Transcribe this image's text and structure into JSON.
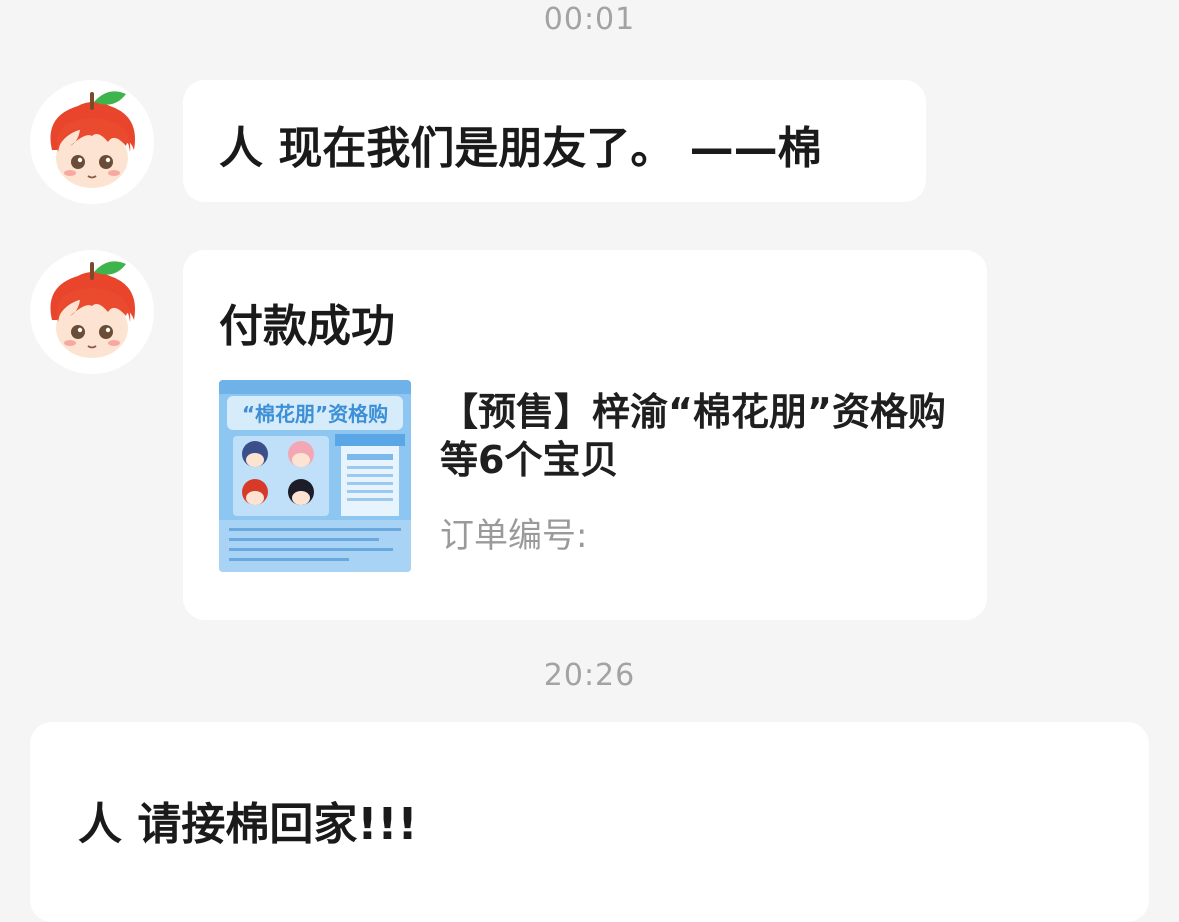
{
  "timestamps": [
    "00:01",
    "20:26"
  ],
  "messages": {
    "m1": {
      "text": "人 现在我们是朋友了。  ——棉"
    },
    "m2": {
      "title": "付款成功",
      "thumb_title": "“棉花朋”资格购",
      "product_title": "【预售】梓渝“棉花朋”资格购等6个宝贝",
      "order_label": "订单编号:"
    },
    "m3": {
      "text": "人 请接棉回家!!!"
    }
  },
  "avatar_icon": "chibi-apple-avatar-icon",
  "colors": {
    "background": "#f5f5f5",
    "bubble": "#ffffff",
    "timestamp": "#a3a3a3",
    "thumb_blue": "#8ec6f2"
  }
}
